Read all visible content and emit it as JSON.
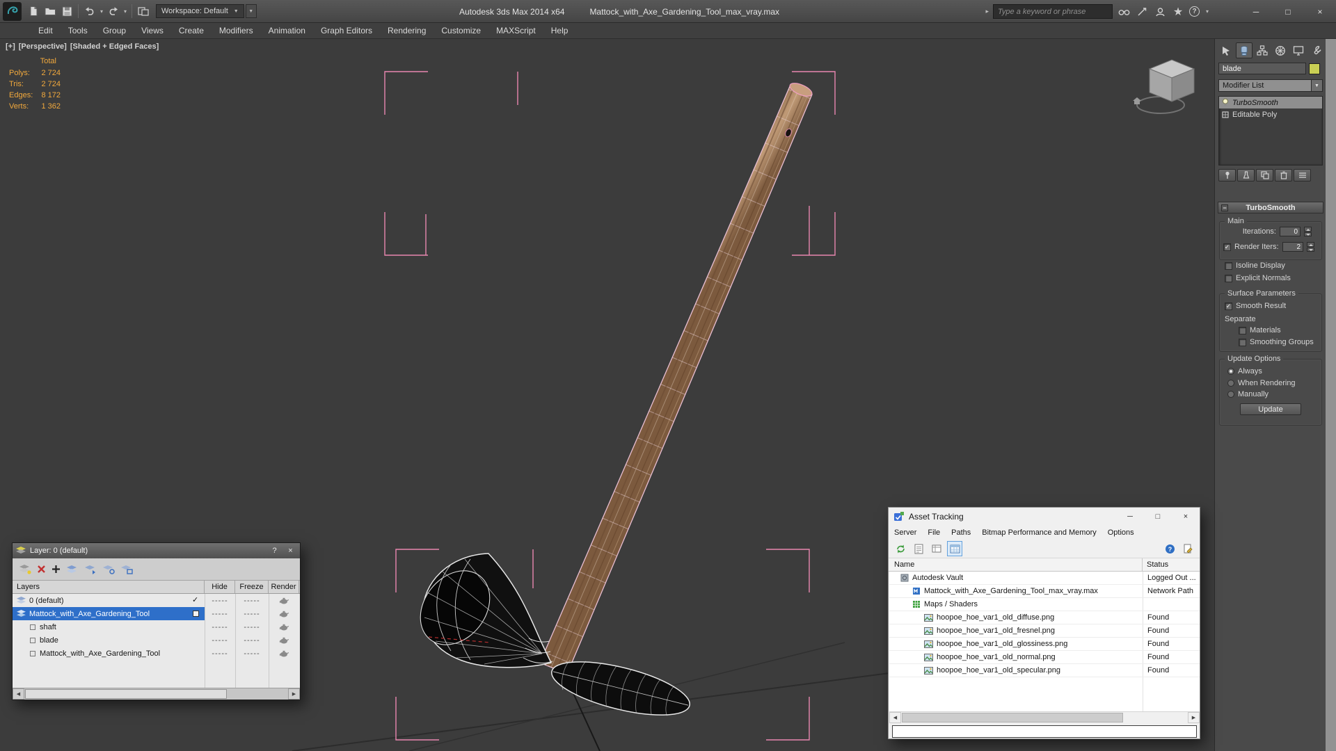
{
  "colors": {
    "selection_blue": "#2e6fc9",
    "stats_orange": "#f2a93c",
    "bracket_pink": "#f28ab6",
    "shaft_tan": "#a5815f",
    "swatch_yellow": "#c9cf54"
  },
  "icons": {
    "check": "✓",
    "caret_down": "▼",
    "caret_small": "▾",
    "collapse": "−",
    "scroll_left": "◀",
    "scroll_right": "▶",
    "search_arrow": "▸",
    "star": "★",
    "help_q": "?"
  },
  "window": {
    "app_title": "Autodesk 3ds Max 2014 x64",
    "doc_title": "Mattock_with_Axe_Gardening_Tool_max_vray.max",
    "workspace": "Workspace: Default",
    "search_placeholder": "Type a keyword or phrase",
    "minimize": "─",
    "maximize": "□",
    "close": "×"
  },
  "menubar": {
    "items": [
      "Edit",
      "Tools",
      "Group",
      "Views",
      "Create",
      "Modifiers",
      "Animation",
      "Graph Editors",
      "Rendering",
      "Customize",
      "MAXScript",
      "Help"
    ]
  },
  "viewport": {
    "label_plus": "[+]",
    "label_view": "[Perspective]",
    "label_shading": "[Shaded + Edged Faces]",
    "stats": {
      "header": "Total",
      "rows": [
        {
          "label": "Polys:",
          "value": "2 724"
        },
        {
          "label": "Tris:",
          "value": "2 724"
        },
        {
          "label": "Edges:",
          "value": "8 172"
        },
        {
          "label": "Verts:",
          "value": "1 362"
        }
      ]
    }
  },
  "command_panel": {
    "object_name": "blade",
    "modifier_list": "Modifier List",
    "stack": [
      {
        "label": "TurboSmooth"
      },
      {
        "label": "Editable Poly"
      }
    ],
    "rollout_title": "TurboSmooth",
    "groups": {
      "main": "Main",
      "surface": "Surface Parameters",
      "update": "Update Options"
    },
    "iterations_label": "Iterations:",
    "iterations_value": "0",
    "render_iters_label": "Render Iters:",
    "render_iters_value": "2",
    "isoline_label": "Isoline Display",
    "explicit_label": "Explicit Normals",
    "smooth_result_label": "Smooth Result",
    "separate_label": "Separate",
    "materials_label": "Materials",
    "smoothing_label": "Smoothing Groups",
    "always_label": "Always",
    "when_label": "When Rendering",
    "manually_label": "Manually",
    "update_button": "Update"
  },
  "layer_dialog": {
    "title": "Layer: 0 (default)",
    "help": "?",
    "close": "×",
    "columns": [
      "Layers",
      "Hide",
      "Freeze",
      "Render"
    ],
    "dashes": "-----",
    "rows": [
      {
        "name": "0 (default)"
      },
      {
        "name": "Mattock_with_Axe_Gardening_Tool"
      },
      {
        "name": "shaft"
      },
      {
        "name": "blade"
      },
      {
        "name": "Mattock_with_Axe_Gardening_Tool"
      }
    ]
  },
  "asset_dialog": {
    "title": "Asset Tracking",
    "minimize": "─",
    "maximize": "□",
    "close": "×",
    "menus": [
      "Server",
      "File",
      "Paths",
      "Bitmap Performance and Memory",
      "Options"
    ],
    "col_name": "Name",
    "col_status": "Status",
    "rows": [
      {
        "name": "Autodesk Vault",
        "status": "Logged Out ..."
      },
      {
        "name": "Mattock_with_Axe_Gardening_Tool_max_vray.max",
        "status": "Network Path"
      },
      {
        "name": "Maps / Shaders",
        "status": ""
      },
      {
        "name": "hoopoe_hoe_var1_old_diffuse.png",
        "status": "Found"
      },
      {
        "name": "hoopoe_hoe_var1_old_fresnel.png",
        "status": "Found"
      },
      {
        "name": "hoopoe_hoe_var1_old_glossiness.png",
        "status": "Found"
      },
      {
        "name": "hoopoe_hoe_var1_old_normal.png",
        "status": "Found"
      },
      {
        "name": "hoopoe_hoe_var1_old_specular.png",
        "status": "Found"
      }
    ]
  }
}
